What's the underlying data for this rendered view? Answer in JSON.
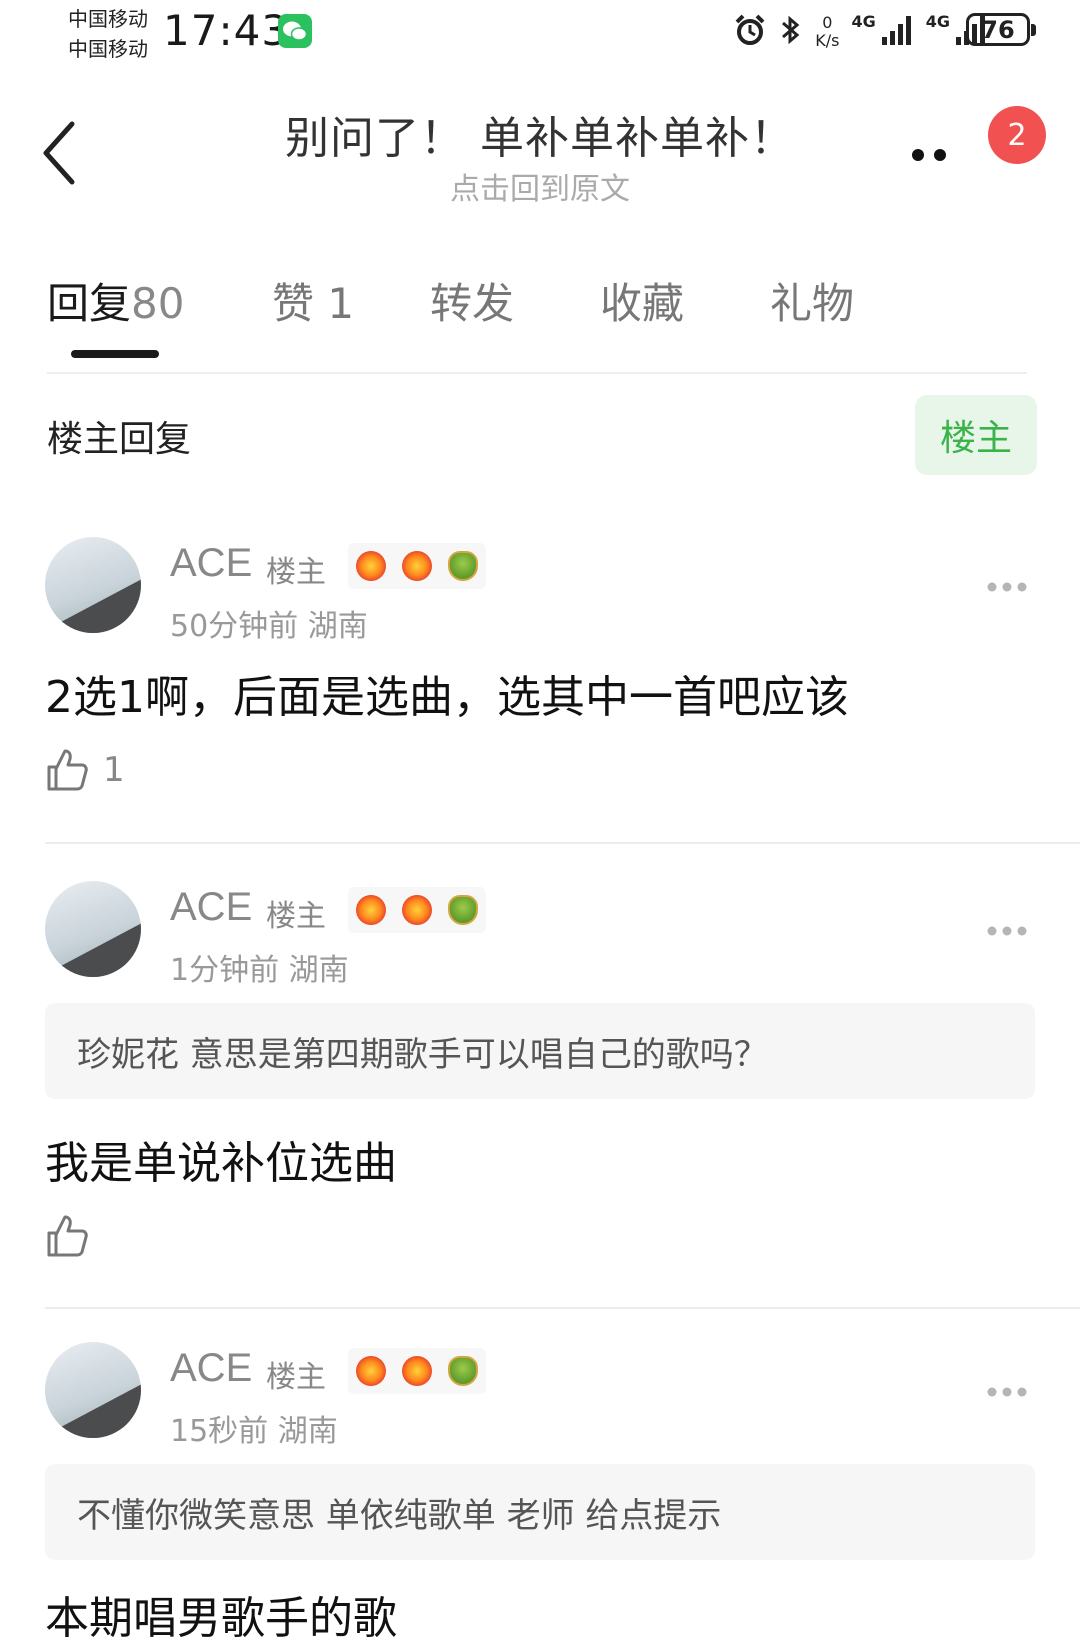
{
  "status_bar": {
    "carrier_1": "中国移动",
    "carrier_2": "中国移动",
    "time": "17:43",
    "speed_value": "0",
    "speed_unit": "K/s",
    "network_1": "4G",
    "network_2": "4G",
    "battery": "76"
  },
  "header": {
    "title": "别问了！ 单补单补单补！",
    "subtitle": "点击回到原文",
    "badge_count": "2"
  },
  "tabs": [
    {
      "label": "回复",
      "count": "80",
      "active": true
    },
    {
      "label": "赞",
      "count": "1",
      "active": false
    },
    {
      "label": "转发",
      "count": "",
      "active": false
    },
    {
      "label": "收藏",
      "count": "",
      "active": false
    },
    {
      "label": "礼物",
      "count": "",
      "active": false
    }
  ],
  "section": {
    "title": "楼主回复",
    "filter_label": "楼主"
  },
  "replies": [
    {
      "user": "ACE",
      "tag": "楼主",
      "time": "50分钟前",
      "location": "湖南",
      "quote": "",
      "body": "2选1啊，后面是选曲，选其中一首吧应该",
      "likes": "1"
    },
    {
      "user": "ACE",
      "tag": "楼主",
      "time": "1分钟前",
      "location": "湖南",
      "quote": "珍妮花 意思是第四期歌手可以唱自己的歌吗？",
      "body": "我是单说补位选曲",
      "likes": ""
    },
    {
      "user": "ACE",
      "tag": "楼主",
      "time": "15秒前",
      "location": "湖南",
      "quote": "不懂你微笑意思 单依纯歌单 老师 给点提示",
      "body": "本期唱男歌手的歌",
      "likes": ""
    }
  ],
  "icons": {
    "back": "chevron-left-icon",
    "more": "more-dots-icon",
    "like": "thumbs-up-icon",
    "badges": [
      "burst-icon",
      "burst-icon",
      "dragon-icon"
    ]
  },
  "colors": {
    "accent_green": "#3bb34b",
    "filter_bg": "#e8f6ea",
    "badge_red": "#f15151",
    "wechat_green": "#2bc15e"
  }
}
